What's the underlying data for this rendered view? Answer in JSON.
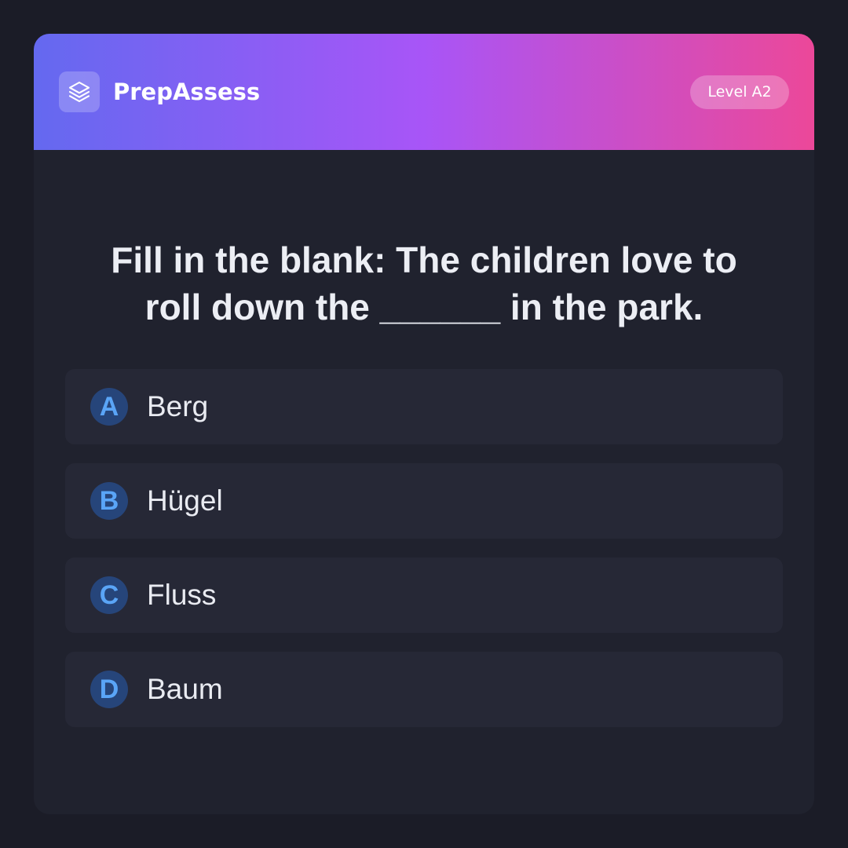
{
  "header": {
    "logo_icon": "stacked-layers-icon",
    "brand": "PrepAssess",
    "level_badge": "Level A2"
  },
  "question": {
    "text": "Fill in the blank: The children love to roll down the ______ in the park."
  },
  "options": [
    {
      "letter": "A",
      "label": "Berg"
    },
    {
      "letter": "B",
      "label": "Hügel"
    },
    {
      "letter": "C",
      "label": "Fluss"
    },
    {
      "letter": "D",
      "label": "Baum"
    }
  ],
  "colors": {
    "page_background": "#1b1c27",
    "card_background": "#20222e",
    "header_gradient": [
      "#6469f0",
      "#a855f7",
      "#ec4899"
    ],
    "option_background": "#262836",
    "letter_circle": "#26457a",
    "letter_text": "#5aa5f7"
  }
}
